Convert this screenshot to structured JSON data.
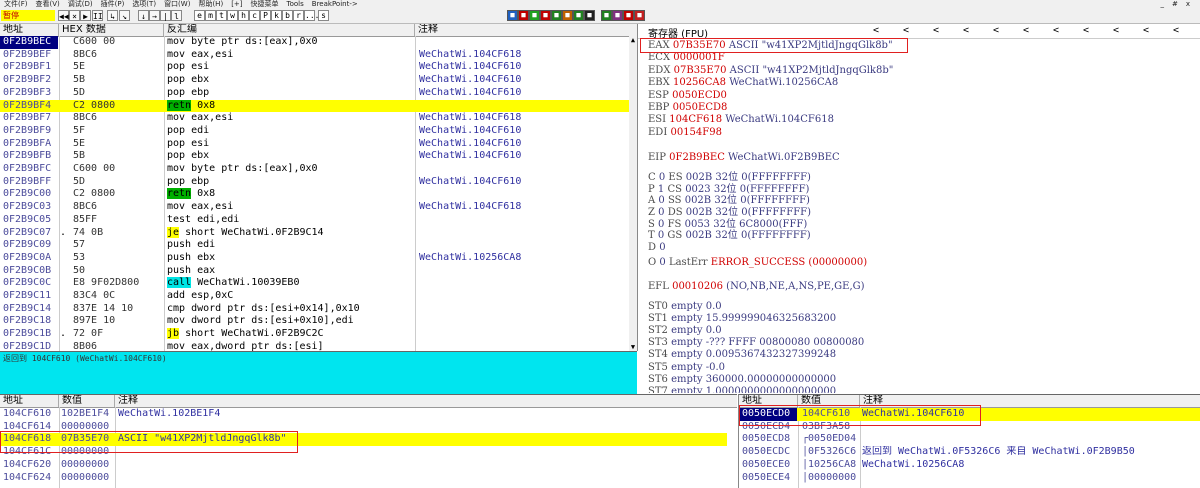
{
  "menubar": {
    "items": [
      "文件(F)",
      "查看(V)",
      "调试(D)",
      "插件(P)",
      "选项(T)",
      "窗口(W)",
      "帮助(H)",
      "[+]",
      "快捷菜单",
      "Tools",
      "BreakPoint->"
    ],
    "window_controls": [
      "_",
      "#",
      "x"
    ]
  },
  "toolbar": {
    "status": "暂停",
    "buttons": [
      "◀◀",
      "×",
      "▶",
      "II",
      "↳",
      "↘",
      "↓",
      "→",
      "|",
      "l",
      "e",
      "m",
      "t",
      "w",
      "h",
      "c",
      "P",
      "k",
      "b",
      "r",
      "...",
      "s"
    ],
    "color_buttons": [
      {
        "label": "■",
        "color": "#2060c0"
      },
      {
        "label": "■",
        "color": "#c00000"
      },
      {
        "label": "■",
        "color": "#20a020"
      },
      {
        "label": "■",
        "color": "#c00000"
      },
      {
        "label": "■",
        "color": "#208020"
      },
      {
        "label": "■",
        "color": "#c06000"
      },
      {
        "label": "■",
        "color": "#208020"
      },
      {
        "label": "■",
        "color": "#202020"
      },
      {
        "label": "■",
        "color": "#208020"
      },
      {
        "label": "■",
        "color": "#803080"
      },
      {
        "label": "■",
        "color": "#c00000"
      },
      {
        "label": "■",
        "color": "#c02020"
      }
    ]
  },
  "disasm": {
    "headers": {
      "addr": "地址",
      "hex": "HEX 数据",
      "disasm": "反汇编",
      "comment": "注释"
    },
    "rows": [
      {
        "addr": "0F2B9BEC",
        "mark": "",
        "hex": "C600 00",
        "mn": "mov",
        "ops": "byte ptr ds:[eax],0x0",
        "cmt": "",
        "cur": true,
        "hl": "",
        "sel": false
      },
      {
        "addr": "0F2B9BEF",
        "mark": "",
        "hex": "8BC6",
        "mn": "mov",
        "ops": "eax,esi",
        "cmt": "WeChatWi.104CF618",
        "cur": false,
        "hl": "",
        "sel": false
      },
      {
        "addr": "0F2B9BF1",
        "mark": "",
        "hex": "5E",
        "mn": "pop",
        "ops": "esi",
        "cmt": "WeChatWi.104CF610",
        "cur": false,
        "hl": "",
        "sel": false
      },
      {
        "addr": "0F2B9BF2",
        "mark": "",
        "hex": "5B",
        "mn": "pop",
        "ops": "ebx",
        "cmt": "WeChatWi.104CF610",
        "cur": false,
        "hl": "",
        "sel": false
      },
      {
        "addr": "0F2B9BF3",
        "mark": "",
        "hex": "5D",
        "mn": "pop",
        "ops": "ebp",
        "cmt": "WeChatWi.104CF610",
        "cur": false,
        "hl": "",
        "sel": false
      },
      {
        "addr": "0F2B9BF4",
        "mark": "",
        "hex": "C2 0800",
        "mn": "retn",
        "ops": "0x8",
        "cmt": "",
        "cur": false,
        "hl": "ret",
        "sel": true
      },
      {
        "addr": "0F2B9BF7",
        "mark": "",
        "hex": "8BC6",
        "mn": "mov",
        "ops": "eax,esi",
        "cmt": "WeChatWi.104CF618",
        "cur": false,
        "hl": "",
        "sel": false
      },
      {
        "addr": "0F2B9BF9",
        "mark": "",
        "hex": "5F",
        "mn": "pop",
        "ops": "edi",
        "cmt": "WeChatWi.104CF610",
        "cur": false,
        "hl": "",
        "sel": false
      },
      {
        "addr": "0F2B9BFA",
        "mark": "",
        "hex": "5E",
        "mn": "pop",
        "ops": "esi",
        "cmt": "WeChatWi.104CF610",
        "cur": false,
        "hl": "",
        "sel": false
      },
      {
        "addr": "0F2B9BFB",
        "mark": "",
        "hex": "5B",
        "mn": "pop",
        "ops": "ebx",
        "cmt": "WeChatWi.104CF610",
        "cur": false,
        "hl": "",
        "sel": false
      },
      {
        "addr": "0F2B9BFC",
        "mark": "",
        "hex": "C600 00",
        "mn": "mov",
        "ops": "byte ptr ds:[eax],0x0",
        "cmt": "",
        "cur": false,
        "hl": "",
        "sel": false
      },
      {
        "addr": "0F2B9BFF",
        "mark": "",
        "hex": "5D",
        "mn": "pop",
        "ops": "ebp",
        "cmt": "WeChatWi.104CF610",
        "cur": false,
        "hl": "",
        "sel": false
      },
      {
        "addr": "0F2B9C00",
        "mark": "",
        "hex": "C2 0800",
        "mn": "retn",
        "ops": "0x8",
        "cmt": "",
        "cur": false,
        "hl": "ret",
        "sel": false
      },
      {
        "addr": "0F2B9C03",
        "mark": "",
        "hex": "8BC6",
        "mn": "mov",
        "ops": "eax,esi",
        "cmt": "WeChatWi.104CF618",
        "cur": false,
        "hl": "",
        "sel": false
      },
      {
        "addr": "0F2B9C05",
        "mark": "",
        "hex": "85FF",
        "mn": "test",
        "ops": "edi,edi",
        "cmt": "",
        "cur": false,
        "hl": "",
        "sel": false
      },
      {
        "addr": "0F2B9C07",
        "mark": ".",
        "hex": "74 0B",
        "mn": "je",
        "ops": "short WeChatWi.0F2B9C14",
        "cmt": "",
        "cur": false,
        "hl": "jmp",
        "sel": false
      },
      {
        "addr": "0F2B9C09",
        "mark": "",
        "hex": "57",
        "mn": "push",
        "ops": "edi",
        "cmt": "",
        "cur": false,
        "hl": "",
        "sel": false
      },
      {
        "addr": "0F2B9C0A",
        "mark": "",
        "hex": "53",
        "mn": "push",
        "ops": "ebx",
        "cmt": "WeChatWi.10256CA8",
        "cur": false,
        "hl": "",
        "sel": false
      },
      {
        "addr": "0F2B9C0B",
        "mark": "",
        "hex": "50",
        "mn": "push",
        "ops": "eax",
        "cmt": "",
        "cur": false,
        "hl": "",
        "sel": false
      },
      {
        "addr": "0F2B9C0C",
        "mark": "",
        "hex": "E8 9F02D800",
        "mn": "call",
        "ops": "WeChatWi.10039EB0",
        "cmt": "",
        "cur": false,
        "hl": "call",
        "sel": false
      },
      {
        "addr": "0F2B9C11",
        "mark": "",
        "hex": "83C4 0C",
        "mn": "add",
        "ops": "esp,0xC",
        "cmt": "",
        "cur": false,
        "hl": "",
        "sel": false
      },
      {
        "addr": "0F2B9C14",
        "mark": "",
        "hex": "837E 14 10",
        "mn": "cmp",
        "ops": "dword ptr ds:[esi+0x14],0x10",
        "cmt": "",
        "cur": false,
        "hl": "",
        "sel": false
      },
      {
        "addr": "0F2B9C18",
        "mark": "",
        "hex": "897E 10",
        "mn": "mov",
        "ops": "dword ptr ds:[esi+0x10],edi",
        "cmt": "",
        "cur": false,
        "hl": "",
        "sel": false
      },
      {
        "addr": "0F2B9C1B",
        "mark": ".",
        "hex": "72 0F",
        "mn": "jb",
        "ops": "short WeChatWi.0F2B9C2C",
        "cmt": "",
        "cur": false,
        "hl": "jmp",
        "sel": false
      },
      {
        "addr": "0F2B9C1D",
        "mark": "",
        "hex": "8B06",
        "mn": "mov",
        "ops": "eax,dword ptr ds:[esi]",
        "cmt": "",
        "cur": false,
        "hl": "",
        "sel": false
      }
    ]
  },
  "info": {
    "text": "返回到 104CF610 (WeChatWi.104CF610)"
  },
  "registers": {
    "title": "寄存器 (FPU)",
    "nav": [
      "<",
      "<",
      "<",
      "<",
      "<",
      "<",
      "<",
      "<",
      "<",
      "<",
      "<"
    ],
    "gp": [
      {
        "name": "EAX",
        "val": "07B35E70",
        "desc": "ASCII \"w41XP2MjtldJngqGlk8b\""
      },
      {
        "name": "ECX",
        "val": "0000001F",
        "desc": ""
      },
      {
        "name": "EDX",
        "val": "07B35E70",
        "desc": "ASCII \"w41XP2MjtldJngqGlk8b\""
      },
      {
        "name": "EBX",
        "val": "10256CA8",
        "desc": "WeChatWi.10256CA8"
      },
      {
        "name": "ESP",
        "val": "0050ECD0",
        "desc": ""
      },
      {
        "name": "EBP",
        "val": "0050ECD8",
        "desc": ""
      },
      {
        "name": "ESI",
        "val": "104CF618",
        "desc": "WeChatWi.104CF618"
      },
      {
        "name": "EDI",
        "val": "00154F98",
        "desc": ""
      }
    ],
    "eip": {
      "name": "EIP",
      "val": "0F2B9BEC",
      "desc": "WeChatWi.0F2B9BEC"
    },
    "flags": [
      {
        "f": "C",
        "v": "0",
        "seg": "ES",
        "sv": "002B",
        "d": "32位 0(FFFFFFFF)"
      },
      {
        "f": "P",
        "v": "1",
        "seg": "CS",
        "sv": "0023",
        "d": "32位 0(FFFFFFFF)"
      },
      {
        "f": "A",
        "v": "0",
        "seg": "SS",
        "sv": "002B",
        "d": "32位 0(FFFFFFFF)"
      },
      {
        "f": "Z",
        "v": "0",
        "seg": "DS",
        "sv": "002B",
        "d": "32位 0(FFFFFFFF)"
      },
      {
        "f": "S",
        "v": "0",
        "seg": "FS",
        "sv": "0053",
        "d": "32位 6C8000(FFF)"
      },
      {
        "f": "T",
        "v": "0",
        "seg": "GS",
        "sv": "002B",
        "d": "32位 0(FFFFFFFF)"
      },
      {
        "f": "D",
        "v": "0",
        "seg": "",
        "sv": "",
        "d": ""
      },
      {
        "f": "O",
        "v": "0",
        "seg": "LastErr",
        "sv": "",
        "d": "ERROR_SUCCESS (00000000)"
      }
    ],
    "efl": {
      "name": "EFL",
      "val": "00010206",
      "desc": "(NO,NB,NE,A,NS,PE,GE,G)"
    },
    "fpu": [
      {
        "name": "ST0",
        "desc": "empty 0.0"
      },
      {
        "name": "ST1",
        "desc": "empty 15.999999046325683200"
      },
      {
        "name": "ST2",
        "desc": "empty 0.0"
      },
      {
        "name": "ST3",
        "desc": "empty -??? FFFF 00800080 00800080"
      },
      {
        "name": "ST4",
        "desc": "empty 0.0095367432327399248"
      },
      {
        "name": "ST5",
        "desc": "empty -0.0"
      },
      {
        "name": "ST6",
        "desc": "empty 360000.00000000000000"
      },
      {
        "name": "ST7",
        "desc": "empty 1.0000000000000000000"
      }
    ]
  },
  "dump": {
    "headers": {
      "addr": "地址",
      "val": "数值",
      "cmt": "注释"
    },
    "rows": [
      {
        "addr": "104CF610",
        "val": "102BE1F4",
        "cmt": "WeChatWi.102BE1F4",
        "sel": false
      },
      {
        "addr": "104CF614",
        "val": "00000000",
        "cmt": "",
        "sel": false
      },
      {
        "addr": "104CF618",
        "val": "07B35E70",
        "cmt": "ASCII \"w41XP2MjtldJngqGlk8b\"",
        "sel": true
      },
      {
        "addr": "104CF61C",
        "val": "00000000",
        "cmt": "",
        "sel": false
      },
      {
        "addr": "104CF620",
        "val": "00000000",
        "cmt": "",
        "sel": false
      },
      {
        "addr": "104CF624",
        "val": "00000000",
        "cmt": "",
        "sel": false
      }
    ]
  },
  "stack": {
    "headers": {
      "addr": "地址",
      "val": "数值",
      "cmt": "注释"
    },
    "rows": [
      {
        "addr": "0050ECD0",
        "val": "104CF610",
        "cmt": "WeChatWi.104CF610",
        "sel": true
      },
      {
        "addr": "0050ECD4",
        "val": "03BF3A58",
        "cmt": "",
        "sel": false
      },
      {
        "addr": "0050ECD8",
        "val": "┌0050ED04",
        "cmt": "",
        "sel": false
      },
      {
        "addr": "0050ECDC",
        "val": "│0F5326C6",
        "cmt": "返回到 WeChatWi.0F5326C6 来自 WeChatWi.0F2B9B50",
        "sel": false
      },
      {
        "addr": "0050ECE0",
        "val": "│10256CA8",
        "cmt": "WeChatWi.10256CA8",
        "sel": false
      },
      {
        "addr": "0050ECE4",
        "val": "│00000000",
        "cmt": "",
        "sel": false
      }
    ]
  }
}
